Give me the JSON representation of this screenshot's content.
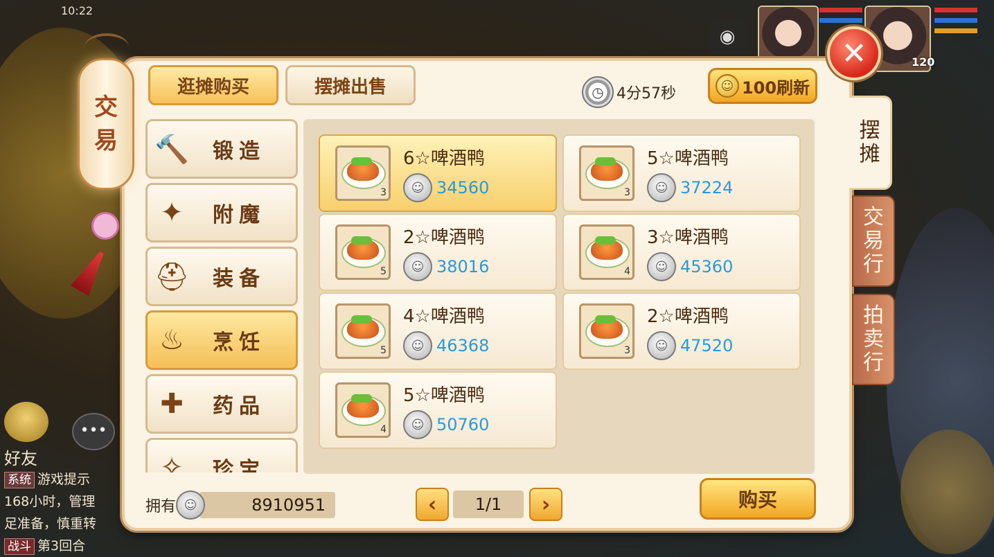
{
  "status": {
    "time": "10:22"
  },
  "hud": {
    "player_level": "120"
  },
  "lantern": {
    "line1": "交",
    "line2": "易"
  },
  "chat": {
    "friend_label": "好友",
    "system_tag": "系统",
    "system_text": "游戏提示",
    "line2": "168小时，管理",
    "line3": "足准备，慎重转",
    "battle_tag": "战斗",
    "battle_text": "第3回合"
  },
  "top_tabs": [
    {
      "label": "逛摊购买",
      "active": true
    },
    {
      "label": "摆摊出售",
      "active": false
    }
  ],
  "timer": {
    "text": "4分57秒"
  },
  "refresh": {
    "label": "100刷新"
  },
  "categories": [
    {
      "label": "锻造",
      "icon": "hammer-icon",
      "glyph": "🔨",
      "active": false
    },
    {
      "label": "附魔",
      "icon": "magic-wand-icon",
      "glyph": "✦",
      "active": false
    },
    {
      "label": "装备",
      "icon": "helmet-icon",
      "glyph": "⛑",
      "active": false
    },
    {
      "label": "烹饪",
      "icon": "cooking-pot-icon",
      "glyph": "♨",
      "active": true
    },
    {
      "label": "药品",
      "icon": "medicine-icon",
      "glyph": "✚",
      "active": false
    },
    {
      "label": "珍宝",
      "icon": "treasure-icon",
      "glyph": "✧",
      "active": false
    }
  ],
  "items": [
    {
      "name": "6☆啤酒鸭",
      "price": "34560",
      "qty": "3",
      "selected": true
    },
    {
      "name": "5☆啤酒鸭",
      "price": "37224",
      "qty": "3",
      "selected": false
    },
    {
      "name": "2☆啤酒鸭",
      "price": "38016",
      "qty": "5",
      "selected": false
    },
    {
      "name": "3☆啤酒鸭",
      "price": "45360",
      "qty": "4",
      "selected": false
    },
    {
      "name": "4☆啤酒鸭",
      "price": "46368",
      "qty": "5",
      "selected": false
    },
    {
      "name": "2☆啤酒鸭",
      "price": "47520",
      "qty": "3",
      "selected": false
    },
    {
      "name": "5☆啤酒鸭",
      "price": "50760",
      "qty": "4",
      "selected": false
    }
  ],
  "footer": {
    "owned_label": "拥有",
    "owned_amount": "8910951",
    "page": "1/1",
    "buy_label": "购买"
  },
  "side_tabs": [
    {
      "label_chars": [
        "摆",
        "摊"
      ],
      "active": true
    },
    {
      "label_chars": [
        "交",
        "易",
        "行"
      ],
      "active": false
    },
    {
      "label_chars": [
        "拍",
        "卖",
        "行"
      ],
      "active": false
    }
  ],
  "colors": {
    "price": "#2a9ad8",
    "accent_gold": "#f2a623",
    "panel": "#fbf3e4"
  }
}
